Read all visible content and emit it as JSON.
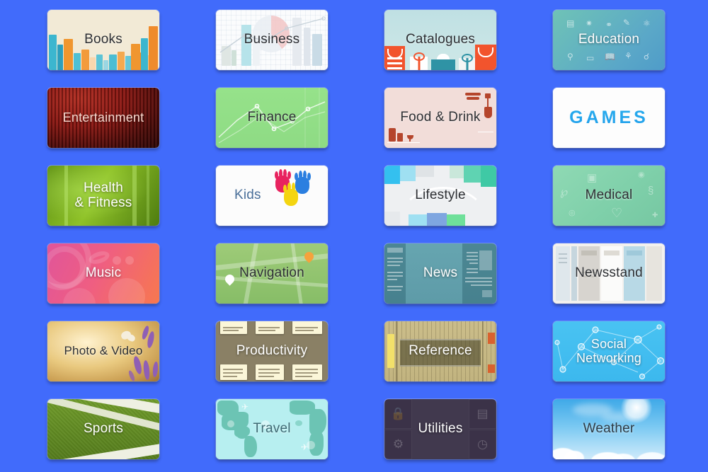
{
  "page": {
    "title": "App Store Categories",
    "background_color": "#416bfb",
    "grid": {
      "columns": 4,
      "rows": 6,
      "tile_count": 24
    }
  },
  "categories": [
    {
      "id": "books",
      "label": "Books",
      "text_style": "dark",
      "accent": "#f2ead6"
    },
    {
      "id": "business",
      "label": "Business",
      "text_style": "dark",
      "accent": "#fbfcfd"
    },
    {
      "id": "catalogues",
      "label": "Catalogues",
      "text_style": "dark",
      "accent": "#bfe0e3"
    },
    {
      "id": "education",
      "label": "Education",
      "text_style": "light",
      "accent": "#6fc3b6"
    },
    {
      "id": "entertainment",
      "label": "Entertainment",
      "text_style": "light",
      "accent": "#8b1510"
    },
    {
      "id": "finance",
      "label": "Finance",
      "text_style": "dark",
      "accent": "#96e28a"
    },
    {
      "id": "fooddrink",
      "label": "Food & Drink",
      "text_style": "dark",
      "accent": "#f2ddd9"
    },
    {
      "id": "games",
      "label": "GAMES",
      "text_style": "logo",
      "accent": "#2fb8f0"
    },
    {
      "id": "health",
      "label": "Health\n& Fitness",
      "text_style": "light",
      "accent": "#8fc228"
    },
    {
      "id": "kids",
      "label": "Kids",
      "text_style": "blue",
      "accent": "#4a6f99"
    },
    {
      "id": "lifestyle",
      "label": "Lifestyle",
      "text_style": "dark",
      "accent": "#eef0f2"
    },
    {
      "id": "medical",
      "label": "Medical",
      "text_style": "dark",
      "accent": "#7ecfa9"
    },
    {
      "id": "music",
      "label": "Music",
      "text_style": "light",
      "accent": "#ef5e82"
    },
    {
      "id": "navigation",
      "label": "Navigation",
      "text_style": "dark",
      "accent": "#87bd67"
    },
    {
      "id": "news",
      "label": "News",
      "text_style": "light",
      "accent": "#5e9ba8"
    },
    {
      "id": "newsstand",
      "label": "Newsstand",
      "text_style": "dark",
      "accent": "#f3f1ee"
    },
    {
      "id": "photovideo",
      "label": "Photo & Video",
      "text_style": "dark",
      "accent": "#e9c97f"
    },
    {
      "id": "productivity",
      "label": "Productivity",
      "text_style": "light",
      "accent": "#8a8065"
    },
    {
      "id": "reference",
      "label": "Reference",
      "text_style": "light",
      "accent": "#c2b480"
    },
    {
      "id": "social",
      "label": "Social\nNetworking",
      "text_style": "light",
      "accent": "#3cb8ee"
    },
    {
      "id": "sports",
      "label": "Sports",
      "text_style": "light",
      "accent": "#557c1c"
    },
    {
      "id": "travel",
      "label": "Travel",
      "text_style": "dark",
      "accent": "#b7eff0"
    },
    {
      "id": "utilities",
      "label": "Utilities",
      "text_style": "light",
      "accent": "#3b3248"
    },
    {
      "id": "weather",
      "label": "Weather",
      "text_style": "dark",
      "accent": "#79c8f2"
    }
  ],
  "icons": {
    "education": [
      "calculator-icon",
      "sun-icon",
      "flask-icon",
      "pencil-note-icon",
      "atom-icon",
      "microscope-icon",
      "eraser-icon",
      "open-book-icon",
      "person-running-icon",
      "hand-icon"
    ],
    "utilities": [
      "lock-icon",
      "calculator-icon",
      "gear-icon",
      "clock-icon"
    ],
    "medical": [
      "first-aid-kit-icon",
      "stethoscope-icon",
      "heart-pulse-icon",
      "dna-icon"
    ],
    "navigation": [
      "map-pin-icon",
      "map-pin-icon"
    ],
    "catalogues": [
      "shopping-bag-icon",
      "gift-icon",
      "box-icon",
      "gift-icon",
      "shopping-bag-icon"
    ],
    "kids": [
      "handprint-icon",
      "handprint-icon",
      "handprint-icon"
    ],
    "photovideo": [
      "butterfly-icon",
      "lavender-icon"
    ],
    "travel": [
      "airplane-icon",
      "airplane-icon"
    ],
    "weather": [
      "sun-icon",
      "cloud-icon"
    ]
  }
}
